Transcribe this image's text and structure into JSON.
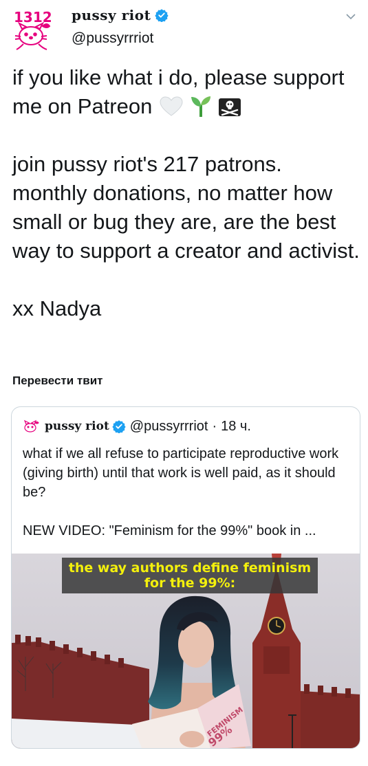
{
  "tweet": {
    "author": {
      "display_name": "pussy riot",
      "handle": "@pussyrrriot",
      "avatar_label": "1312"
    },
    "text": {
      "line1": "if you like what i do, please support me on Patreon",
      "para2": "join pussy riot's 217 patrons. monthly donations, no matter how small or bug they are, are the best way to support a creator and activist.",
      "sign": "xx Nadya"
    },
    "translate_label": "Перевести твит"
  },
  "quote": {
    "author": {
      "display_name": "pussy riot",
      "handle": "@pussyrrriot",
      "separator": "·",
      "time": "18 ч."
    },
    "text": {
      "para1": "what if we all refuse to participate reproductive work (giving birth) until that work is well paid, as it should be?",
      "para2": "NEW VIDEO: \"Feminism for the 99%\" book in ..."
    },
    "media": {
      "caption": "the way authors define feminism for the 99%:",
      "book_title": "FEMINISM",
      "book_number": "99%"
    }
  },
  "colors": {
    "text": "#14171a",
    "secondary": "#657786",
    "verified": "#1da1f2",
    "avatar_pink": "#e6007e",
    "caption_yellow": "#f4f00c"
  },
  "icons": [
    "verified-badge-icon",
    "chevron-down-icon",
    "white-heart-emoji",
    "seedling-emoji",
    "pirate-flag-emoji"
  ]
}
